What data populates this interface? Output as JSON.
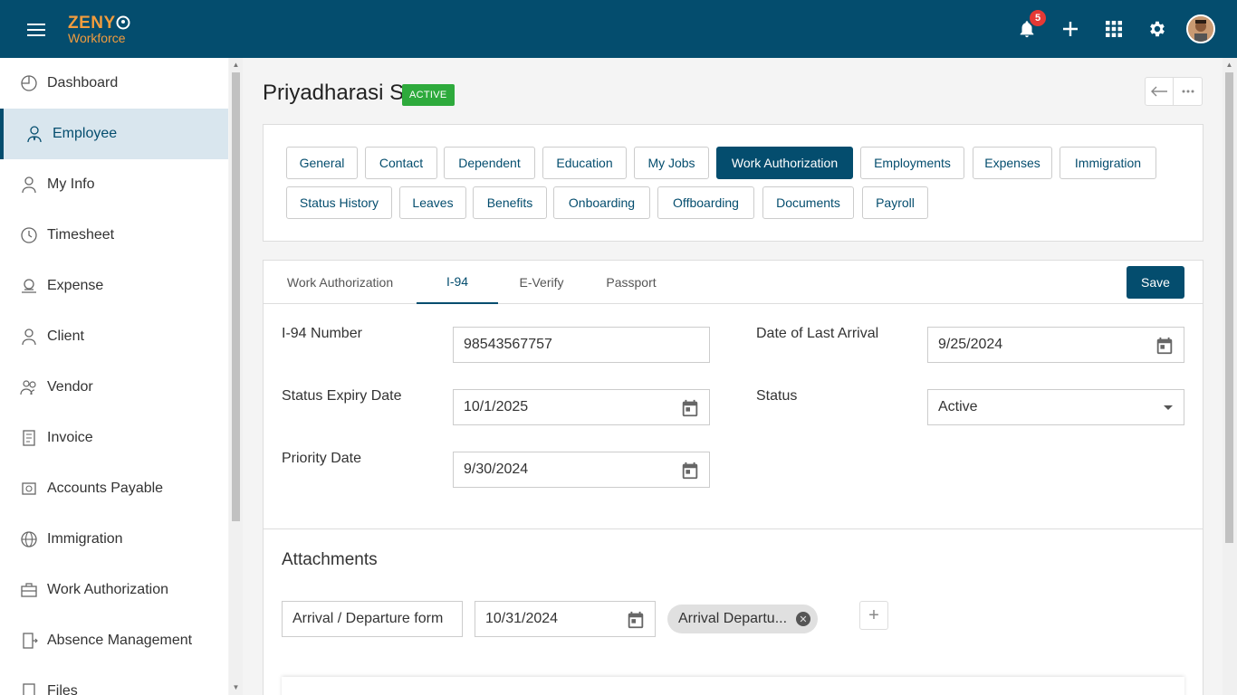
{
  "brand": {
    "logo_top": "ZENY",
    "logo_bottom": "Workforce",
    "colors": {
      "primary": "#044d6e",
      "accent": "#f39c3d",
      "success": "#2eaa3c",
      "danger": "#e53935"
    }
  },
  "topbar": {
    "notifications_count": "5",
    "icons": [
      "bell-icon",
      "plus-icon",
      "apps-grid-icon",
      "gear-icon",
      "user-avatar"
    ]
  },
  "sidebar": {
    "items": [
      {
        "label": "Dashboard",
        "icon": "dashboard-icon"
      },
      {
        "label": "Employee",
        "icon": "employee-icon",
        "active": true
      },
      {
        "label": "My Info",
        "icon": "my-info-icon"
      },
      {
        "label": "Timesheet",
        "icon": "clock-icon"
      },
      {
        "label": "Expense",
        "icon": "expense-icon"
      },
      {
        "label": "Client",
        "icon": "client-icon"
      },
      {
        "label": "Vendor",
        "icon": "vendor-icon"
      },
      {
        "label": "Invoice",
        "icon": "invoice-icon"
      },
      {
        "label": "Accounts Payable",
        "icon": "accounts-payable-icon"
      },
      {
        "label": "Immigration",
        "icon": "globe-icon"
      },
      {
        "label": "Work Authorization",
        "icon": "briefcase-icon"
      },
      {
        "label": "Absence Management",
        "icon": "door-icon"
      },
      {
        "label": "Files",
        "icon": "files-icon"
      }
    ]
  },
  "header": {
    "name": "Priyadharasi S",
    "status": "ACTIVE"
  },
  "section_tabs": [
    "General",
    "Contact",
    "Dependent",
    "Education",
    "My Jobs",
    "Work Authorization",
    "Employments",
    "Expenses",
    "Immigration",
    "Status History",
    "Leaves",
    "Benefits",
    "Onboarding",
    "Offboarding",
    "Documents",
    "Payroll"
  ],
  "active_section": "Work Authorization",
  "sub_tabs": [
    "Work Authorization",
    "I-94",
    "E-Verify",
    "Passport"
  ],
  "active_sub_tab": "I-94",
  "save_label": "Save",
  "form": {
    "i94_number_label": "I-94 Number",
    "i94_number_value": "98543567757",
    "last_arrival_label": "Date of Last Arrival",
    "last_arrival_value": "9/25/2024",
    "status_expiry_label": "Status Expiry Date",
    "status_expiry_value": "10/1/2025",
    "status_label": "Status",
    "status_value": "Active",
    "priority_date_label": "Priority Date",
    "priority_date_value": "9/30/2024"
  },
  "attachments": {
    "title": "Attachments",
    "doc_type": "Arrival / Departure form",
    "doc_date": "10/31/2024",
    "file_chip": "Arrival Departu..."
  }
}
